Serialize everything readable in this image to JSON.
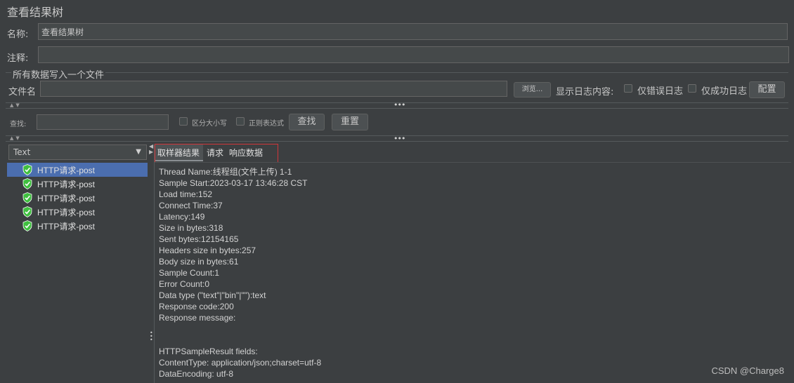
{
  "panel_title": "查看结果树",
  "name_label": "名称:",
  "name_value": "查看结果树",
  "comment_label": "注释:",
  "comment_value": "",
  "file_group_title": "所有数据写入一个文件",
  "filename_label": "文件名",
  "filename_value": "",
  "browse_label": "浏览...",
  "log_content_label": "显示日志内容:",
  "errors_only_label": "仅错误日志",
  "success_only_label": "仅成功日志",
  "configure_label": "配置",
  "search": {
    "label": "查找:",
    "value": "",
    "case_sensitive_label": "区分大小写",
    "regex_label": "正则表达式",
    "find_label": "查找",
    "reset_label": "重置"
  },
  "renderer_select": "Text",
  "tree_items": [
    {
      "label": "HTTP请求-post",
      "selected": true
    },
    {
      "label": "HTTP请求-post",
      "selected": false
    },
    {
      "label": "HTTP请求-post",
      "selected": false
    },
    {
      "label": "HTTP请求-post",
      "selected": false
    },
    {
      "label": "HTTP请求-post",
      "selected": false
    }
  ],
  "tabs": [
    "取样器结果",
    "请求",
    "响应数据"
  ],
  "result_lines": [
    "Thread Name:线程组(文件上传) 1-1",
    "Sample Start:2023-03-17 13:46:28 CST",
    "Load time:152",
    "Connect Time:37",
    "Latency:149",
    "Size in bytes:318",
    "Sent bytes:12154165",
    "Headers size in bytes:257",
    "Body size in bytes:61",
    "Sample Count:1",
    "Error Count:0",
    "Data type (\"text\"|\"bin\"|\"\"):text",
    "Response code:200",
    "Response message:",
    "",
    "",
    "HTTPSampleResult fields:",
    "ContentType: application/json;charset=utf-8",
    "DataEncoding: utf-8"
  ],
  "watermark": "CSDN @Charge8",
  "colors": {
    "background": "#3c3f41",
    "selection": "#4b6eaf",
    "tab_highlight_border": "#d0353a",
    "success_icon": "#3fbf3f"
  }
}
